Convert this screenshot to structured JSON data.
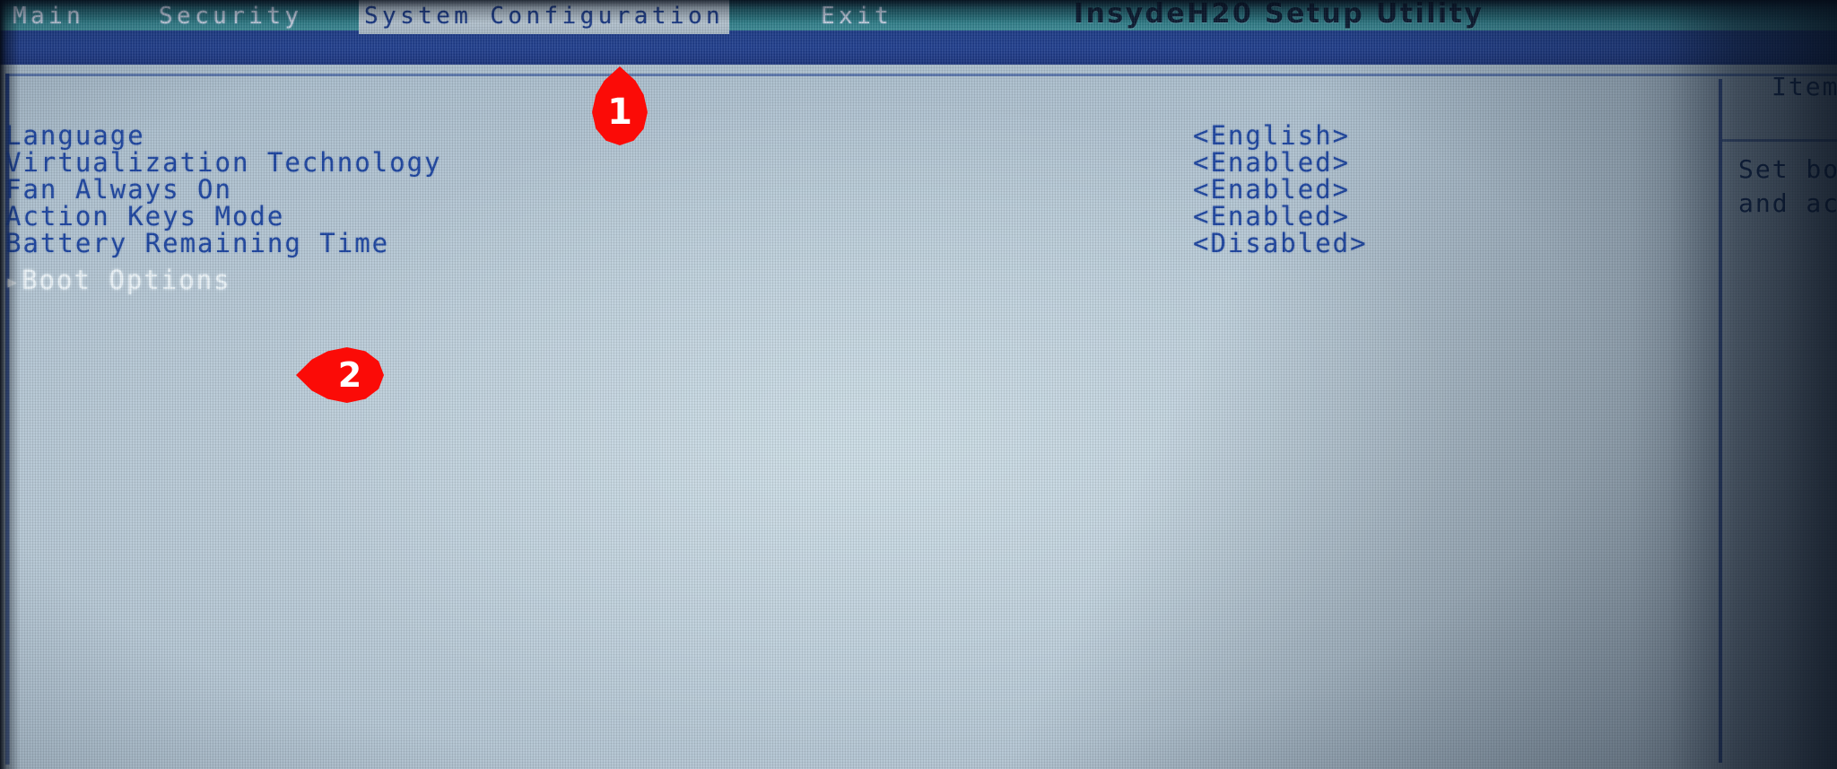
{
  "window": {
    "title": "InsydeH20 Setup Utility"
  },
  "menubar": {
    "items": [
      {
        "label": "Main",
        "active": false
      },
      {
        "label": "Security",
        "active": false
      },
      {
        "label": "System Configuration",
        "active": true
      },
      {
        "label": "Exit",
        "active": false
      }
    ]
  },
  "settings": {
    "rows": [
      {
        "label": "Language",
        "value": "<English>",
        "selected": false,
        "submenu": false
      },
      {
        "label": "Virtualization Technology",
        "value": "<Enabled>",
        "selected": false,
        "submenu": false
      },
      {
        "label": "Fan Always On",
        "value": "<Enabled>",
        "selected": false,
        "submenu": false
      },
      {
        "label": "Action Keys Mode",
        "value": "<Enabled>",
        "selected": false,
        "submenu": false
      },
      {
        "label": "Battery Remaining Time",
        "value": "<Disabled>",
        "selected": false,
        "submenu": false
      },
      {
        "label": "Boot Options",
        "value": "",
        "selected": true,
        "submenu": true,
        "arrow": "▸"
      }
    ]
  },
  "help_panel": {
    "title": "Item",
    "line1": "Set bo",
    "line2": "and ac"
  },
  "annotations": {
    "markers": [
      {
        "label": "1",
        "shape": "teardrop-up",
        "target": "system-configuration-tab"
      },
      {
        "label": "2",
        "shape": "teardrop-left",
        "target": "boot-options-row"
      }
    ]
  },
  "colors": {
    "title_band": "#2e8490",
    "menu_bar": "#21439b",
    "screen_background": "#b9cad7",
    "option_text": "#1e46a0",
    "selected_text": "#e9f1f6",
    "marker_red": "#fb0b07"
  }
}
